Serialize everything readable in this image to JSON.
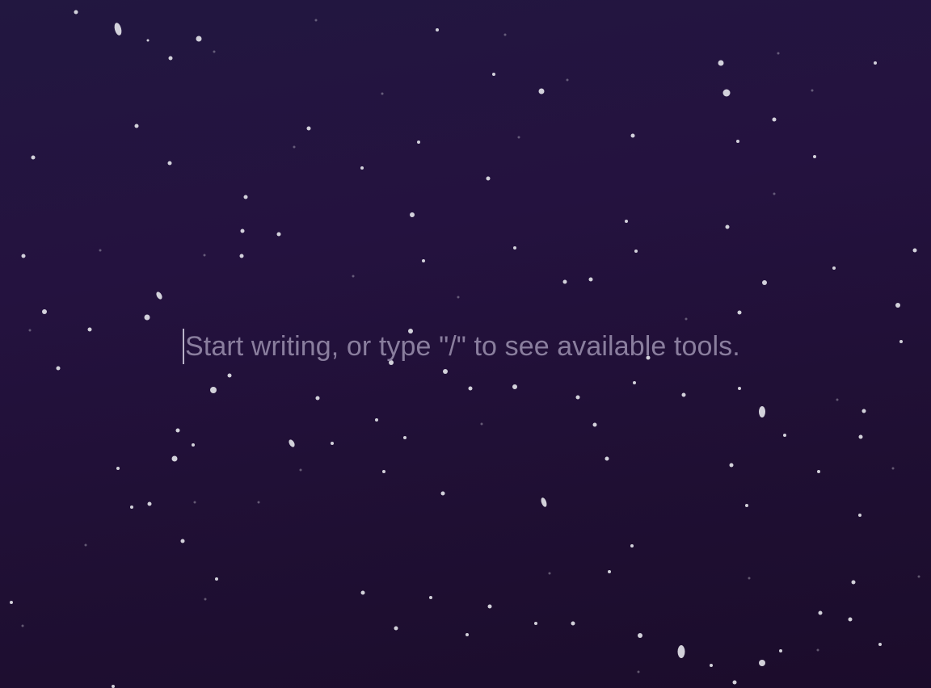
{
  "editor": {
    "placeholder": "Start writing, or type \"/\" to see available tools.",
    "value": ""
  },
  "background": {
    "gradient_top": "#221740",
    "gradient_bottom": "#1b0c2b",
    "particle_color": "#e8e8ee",
    "placeholder_color": "#8a7e9e"
  }
}
